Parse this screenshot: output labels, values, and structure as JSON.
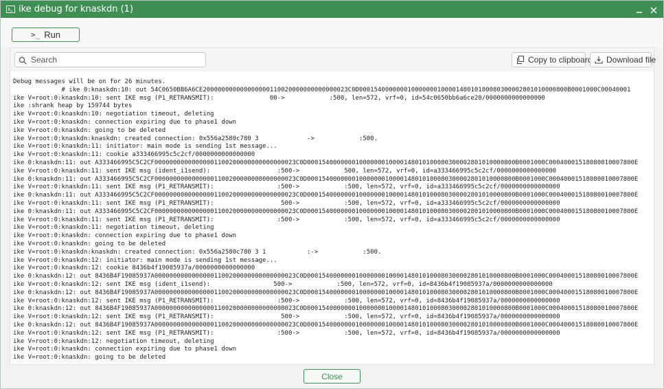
{
  "window": {
    "title": "ike debug for knaskdn (1)",
    "accent_color": "#3f8f55"
  },
  "toolbar": {
    "run_label": "Run",
    "run_icon": ">_"
  },
  "search": {
    "placeholder": "Search",
    "value": ""
  },
  "actions": {
    "copy_label": "Copy to clipboard",
    "download_label": "Download file"
  },
  "log_lines": [
    "Debug messages will be on for 26 minutes.",
    "             # ike 0:knaskdn:10: out 54C0650BB6A6CE200000000000000000110020000000000000023C0D00015400000001000000010000148010100080300002801010000800B0001000C00040001",
    "ike V=root:0:knaskdn:10: sent IKE msg (P1_RETRANSMIT):               00->            :500, len=572, vrf=0, id=54c0650bb6a6ce20/0000000000000000",
    "ike :shrank heap by 159744 bytes",
    "ike V=root:0:knaskdn:10: negotiation timeout, deleting",
    "ike V=root:0:knaskdn: connection expiring due to phase1 down",
    "ike V=root:0:knaskdn: going to be deleted",
    "ike V=root:0:knaskdn:knaskdn: created connection: 0x556a2580c780 3             ->            :500.",
    "ike V=root:0:knaskdn:11: initiator: main mode is sending 1st message...",
    "ike V=root:0:knaskdn:11: cookie a333466995c5c2cf/0000000000000000",
    "ike 0:knaskdn:11: out A333466995C5C2CF00000000000000001100200000000000000023C0D00015400000001000000010000148010100080300002801010000800B0001000C00040001518080010007800E",
    "ike V=root:0:knaskdn:11: sent IKE msg (ident_i1send):                  :500->            500, len=572, vrf=0, id=a333466995c5c2cf/0000000000000000",
    "ike 0:knaskdn:11: out A333466995C5C2CF00000000000000001100200000000000000023C0D00015400000001000000010000148010100080300002801010000800B0001000C00040001518080010007800E",
    "ike V=root:0:knaskdn:11: sent IKE msg (P1_RETRANSMIT):                 :500->            :500, len=572, vrf=0, id=a333466995c5c2cf/0000000000000000",
    "ike 0:knaskdn:11: out A333466995C5C2CF00000000000000001100200000000000000023C0D00015400000001000000010000148010100080300002801010000800B0001000C00040001518080010007800E",
    "ike V=root:0:knaskdn:11: sent IKE msg (P1_RETRANSMIT):                  500->            :500, len=572, vrf=0, id=a333466995c5c2cf/0000000000000000",
    "ike 0:knaskdn:11: out A333466995C5C2CF00000000000000001100200000000000000023C0D00015400000001000000010000148010100080300002801010000800B0001000C00040001518080010007800E",
    "ike V=root:0:knaskdn:11: sent IKE msg (P1_RETRANSMIT):                 :500->            :500, len=572, vrf=0, id=a333466995c5c2cf/0000000000000000",
    "ike V=root:0:knaskdn:11: negotiation timeout, deleting",
    "ike V=root:0:knaskdn: connection expiring due to phase1 down",
    "ike V=root:0:knaskdn: going to be deleted",
    "ike V=root:0:knaskdn:knaskdn: created connection: 0x556a2580c780 3 1           :->            :500.",
    "ike V=root:0:knaskdn:12: initiator: main mode is sending 1st message...",
    "ike V=root:0:knaskdn:12: cookie 8436b4f19085937a/0000000000000000",
    "ike 0:knaskdn:12: out 8436B4F19085937A00000000000000001100200000000000000023C0D00015400000001000000010000148010100080300002801010000800B0001000C00040001518080010007800E",
    "ike V=root:0:knaskdn:12: sent IKE msg (ident_i1send):                 500->            :500, len=572, vrf=0, id=8436b4f19085937a/0000000000000000",
    "ike 0:knaskdn:12: out 8436B4F19085937A00000000000000001100200000000000000023C0D00015400000001000000010000148010100080300002801010000800B0001000C00040001518080010007800E",
    "ike V=root:0:knaskdn:12: sent IKE msg (P1_RETRANSMIT):                 :500->            :500, len=572, vrf=0, id=8436b4f19085937a/0000000000000000",
    "ike 0:knaskdn:12: out 8436B4F19085937A00000000000000001100200000000000000023C0D00015400000001000000010000148010100080300002801010000800B0001000C00040001518080010007800E",
    "ike V=root:0:knaskdn:12: sent IKE msg (P1_RETRANSMIT):                  500->            :500, len=572, vrf=0, id=8436b4f19085937a/0000000000000000",
    "ike 0:knaskdn:12: out 8436B4F19085937A00000000000000001100200000000000000023C0D00015400000001000000010000148010100080300002801010000800B0001000C00040001518080010007800E",
    "ike V=root:0:knaskdn:12: sent IKE msg (P1_RETRANSMIT):                 :500->            :500, len=572, vrf=0, id=8436b4f19085937a/0000000000000000",
    "ike V=root:0:knaskdn:12: negotiation timeout, deleting",
    "ike V=root:0:knaskdn: connection expiring due to phase1 down",
    "ike V=root:0:knaskdn: going to be deleted"
  ],
  "footer": {
    "close_label": "Close"
  }
}
